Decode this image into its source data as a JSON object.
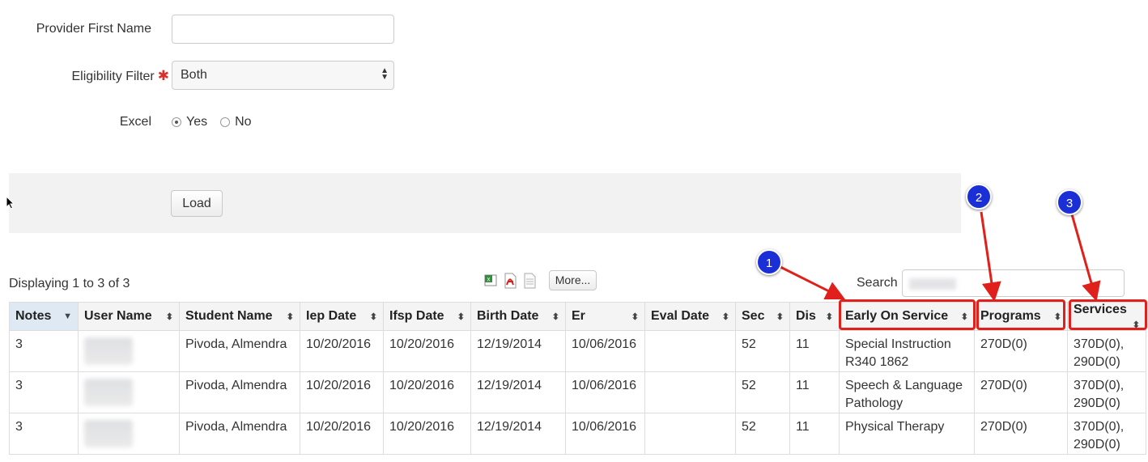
{
  "form": {
    "provider_first_name_label": "Provider First Name",
    "provider_first_name_value": "",
    "eligibility_label": "Eligibility Filter",
    "eligibility_required": "✱",
    "eligibility_value": "Both",
    "excel_label": "Excel",
    "excel_yes": "Yes",
    "excel_no": "No",
    "excel_selected": "Yes",
    "load_button": "Load"
  },
  "toolbar": {
    "displaying": "Displaying 1 to 3 of 3",
    "more_button": "More...",
    "search_label": "Search",
    "export_icons": [
      "excel-icon",
      "pdf-icon",
      "text-file-icon"
    ]
  },
  "table": {
    "columns": [
      "Notes",
      "User Name",
      "Student Name",
      "Iep Date",
      "Ifsp Date",
      "Birth Date",
      "Er",
      "Eval Date",
      "Sec",
      "Dis",
      "Early On Service",
      "Programs",
      "Services"
    ],
    "rows": [
      {
        "notes": "3",
        "student": "Pivoda, Almendra",
        "iep": "10/20/2016",
        "ifsp": "10/20/2016",
        "birth": "12/19/2014",
        "er": "10/06/2016",
        "eval": "",
        "sec": "52",
        "dis": "11",
        "early1": "Special Instruction",
        "early2": "R340 1862",
        "programs": "270D(0)",
        "services1": "370D(0),",
        "services2": "290D(0)"
      },
      {
        "notes": "3",
        "student": "Pivoda, Almendra",
        "iep": "10/20/2016",
        "ifsp": "10/20/2016",
        "birth": "12/19/2014",
        "er": "10/06/2016",
        "eval": "",
        "sec": "52",
        "dis": "11",
        "early1": "Speech & Language",
        "early2": "Pathology",
        "programs": "270D(0)",
        "services1": "370D(0),",
        "services2": "290D(0)"
      },
      {
        "notes": "3",
        "student": "Pivoda, Almendra",
        "iep": "10/20/2016",
        "ifsp": "10/20/2016",
        "birth": "12/19/2014",
        "er": "10/06/2016",
        "eval": "",
        "sec": "52",
        "dis": "11",
        "early1": "Physical Therapy",
        "early2": "",
        "programs": "270D(0)",
        "services1": "370D(0),",
        "services2": "290D(0)"
      }
    ]
  },
  "annotations": {
    "badges": [
      "1",
      "2",
      "3"
    ],
    "color_badge": "#1b2fd6",
    "color_highlight": "#e0201a"
  }
}
